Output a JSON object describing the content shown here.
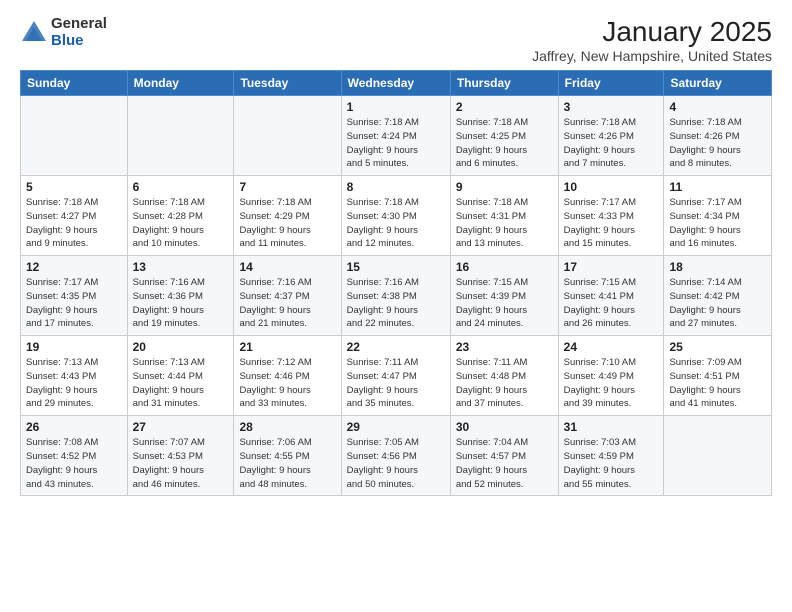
{
  "header": {
    "logo_general": "General",
    "logo_blue": "Blue",
    "month_title": "January 2025",
    "location": "Jaffrey, New Hampshire, United States"
  },
  "weekdays": [
    "Sunday",
    "Monday",
    "Tuesday",
    "Wednesday",
    "Thursday",
    "Friday",
    "Saturday"
  ],
  "weeks": [
    [
      {
        "day": "",
        "info": ""
      },
      {
        "day": "",
        "info": ""
      },
      {
        "day": "",
        "info": ""
      },
      {
        "day": "1",
        "info": "Sunrise: 7:18 AM\nSunset: 4:24 PM\nDaylight: 9 hours\nand 5 minutes."
      },
      {
        "day": "2",
        "info": "Sunrise: 7:18 AM\nSunset: 4:25 PM\nDaylight: 9 hours\nand 6 minutes."
      },
      {
        "day": "3",
        "info": "Sunrise: 7:18 AM\nSunset: 4:26 PM\nDaylight: 9 hours\nand 7 minutes."
      },
      {
        "day": "4",
        "info": "Sunrise: 7:18 AM\nSunset: 4:26 PM\nDaylight: 9 hours\nand 8 minutes."
      }
    ],
    [
      {
        "day": "5",
        "info": "Sunrise: 7:18 AM\nSunset: 4:27 PM\nDaylight: 9 hours\nand 9 minutes."
      },
      {
        "day": "6",
        "info": "Sunrise: 7:18 AM\nSunset: 4:28 PM\nDaylight: 9 hours\nand 10 minutes."
      },
      {
        "day": "7",
        "info": "Sunrise: 7:18 AM\nSunset: 4:29 PM\nDaylight: 9 hours\nand 11 minutes."
      },
      {
        "day": "8",
        "info": "Sunrise: 7:18 AM\nSunset: 4:30 PM\nDaylight: 9 hours\nand 12 minutes."
      },
      {
        "day": "9",
        "info": "Sunrise: 7:18 AM\nSunset: 4:31 PM\nDaylight: 9 hours\nand 13 minutes."
      },
      {
        "day": "10",
        "info": "Sunrise: 7:17 AM\nSunset: 4:33 PM\nDaylight: 9 hours\nand 15 minutes."
      },
      {
        "day": "11",
        "info": "Sunrise: 7:17 AM\nSunset: 4:34 PM\nDaylight: 9 hours\nand 16 minutes."
      }
    ],
    [
      {
        "day": "12",
        "info": "Sunrise: 7:17 AM\nSunset: 4:35 PM\nDaylight: 9 hours\nand 17 minutes."
      },
      {
        "day": "13",
        "info": "Sunrise: 7:16 AM\nSunset: 4:36 PM\nDaylight: 9 hours\nand 19 minutes."
      },
      {
        "day": "14",
        "info": "Sunrise: 7:16 AM\nSunset: 4:37 PM\nDaylight: 9 hours\nand 21 minutes."
      },
      {
        "day": "15",
        "info": "Sunrise: 7:16 AM\nSunset: 4:38 PM\nDaylight: 9 hours\nand 22 minutes."
      },
      {
        "day": "16",
        "info": "Sunrise: 7:15 AM\nSunset: 4:39 PM\nDaylight: 9 hours\nand 24 minutes."
      },
      {
        "day": "17",
        "info": "Sunrise: 7:15 AM\nSunset: 4:41 PM\nDaylight: 9 hours\nand 26 minutes."
      },
      {
        "day": "18",
        "info": "Sunrise: 7:14 AM\nSunset: 4:42 PM\nDaylight: 9 hours\nand 27 minutes."
      }
    ],
    [
      {
        "day": "19",
        "info": "Sunrise: 7:13 AM\nSunset: 4:43 PM\nDaylight: 9 hours\nand 29 minutes."
      },
      {
        "day": "20",
        "info": "Sunrise: 7:13 AM\nSunset: 4:44 PM\nDaylight: 9 hours\nand 31 minutes."
      },
      {
        "day": "21",
        "info": "Sunrise: 7:12 AM\nSunset: 4:46 PM\nDaylight: 9 hours\nand 33 minutes."
      },
      {
        "day": "22",
        "info": "Sunrise: 7:11 AM\nSunset: 4:47 PM\nDaylight: 9 hours\nand 35 minutes."
      },
      {
        "day": "23",
        "info": "Sunrise: 7:11 AM\nSunset: 4:48 PM\nDaylight: 9 hours\nand 37 minutes."
      },
      {
        "day": "24",
        "info": "Sunrise: 7:10 AM\nSunset: 4:49 PM\nDaylight: 9 hours\nand 39 minutes."
      },
      {
        "day": "25",
        "info": "Sunrise: 7:09 AM\nSunset: 4:51 PM\nDaylight: 9 hours\nand 41 minutes."
      }
    ],
    [
      {
        "day": "26",
        "info": "Sunrise: 7:08 AM\nSunset: 4:52 PM\nDaylight: 9 hours\nand 43 minutes."
      },
      {
        "day": "27",
        "info": "Sunrise: 7:07 AM\nSunset: 4:53 PM\nDaylight: 9 hours\nand 46 minutes."
      },
      {
        "day": "28",
        "info": "Sunrise: 7:06 AM\nSunset: 4:55 PM\nDaylight: 9 hours\nand 48 minutes."
      },
      {
        "day": "29",
        "info": "Sunrise: 7:05 AM\nSunset: 4:56 PM\nDaylight: 9 hours\nand 50 minutes."
      },
      {
        "day": "30",
        "info": "Sunrise: 7:04 AM\nSunset: 4:57 PM\nDaylight: 9 hours\nand 52 minutes."
      },
      {
        "day": "31",
        "info": "Sunrise: 7:03 AM\nSunset: 4:59 PM\nDaylight: 9 hours\nand 55 minutes."
      },
      {
        "day": "",
        "info": ""
      }
    ]
  ]
}
